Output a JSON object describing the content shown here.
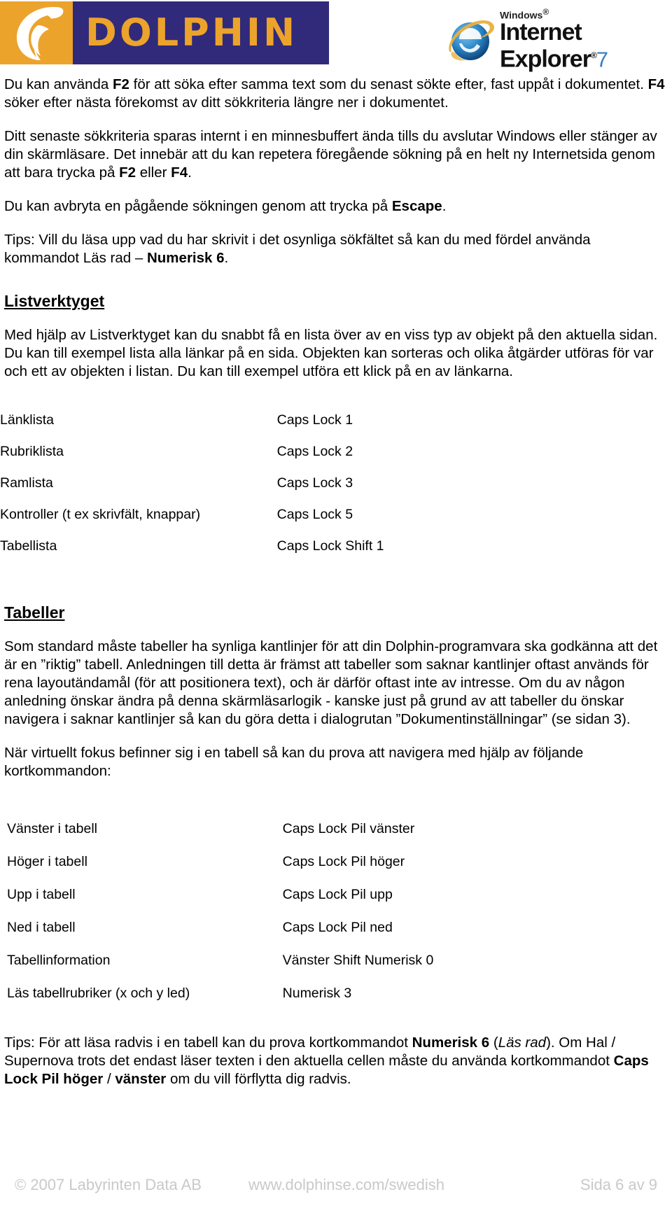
{
  "header": {
    "dolphin_logo": {
      "wordmark": "DOLPHIN",
      "bg_color": "#312a7a",
      "accent_color": "#eca32c"
    },
    "ie_logo": {
      "windows": "Windows",
      "line1": "Internet",
      "line2": "Explorer",
      "version": "7",
      "tm": "®"
    }
  },
  "content": {
    "p1_a": "Du kan använda ",
    "p1_b1": "F2",
    "p1_c": " för att söka efter samma text som du senast sökte efter, fast uppåt i dokumentet. ",
    "p1_b2": "F4",
    "p1_d": " söker efter nästa förekomst av ditt sökkriteria längre ner i dokumentet.",
    "p2_a": "Ditt senaste sökkriteria sparas internt i en minnesbuffert ända tills du avslutar Windows eller stänger av din skärmläsare. Det innebär att du kan repetera föregående sökning på en helt ny Internetsida genom att bara trycka på ",
    "p2_b1": "F2",
    "p2_c": " eller ",
    "p2_b2": "F4",
    "p2_d": ".",
    "p3_a": "Du kan avbryta en pågående sökningen genom att trycka på ",
    "p3_b": "Escape",
    "p3_c": ".",
    "p4_a": "Tips: Vill du läsa upp vad du har skrivit i det osynliga sökfältet så kan du med fördel använda kommandot Läs rad – ",
    "p4_b": "Numerisk 6",
    "p4_c": ".",
    "heading_listverktyget": "Listverktyget",
    "p5": "Med hjälp av Listverktyget kan du snabbt få en lista över av en viss typ av objekt på den aktuella sidan. Du kan till exempel lista alla länkar på en sida. Objekten kan sorteras och olika åtgärder utföras för var och ett av objekten i listan. Du kan till exempel utföra ett klick på en av länkarna.",
    "heading_tabeller": "Tabeller",
    "p6": "Som standard måste tabeller ha synliga kantlinjer för att din Dolphin-programvara ska godkänna att det är en ”riktig” tabell. Anledningen till detta är främst att tabeller som saknar kantlinjer oftast används för rena layoutändamål (för att positionera text), och är därför oftast inte av intresse. Om du av någon anledning önskar ändra på denna skärmläsarlogik - kanske just på grund av att tabeller du önskar navigera i saknar kantlinjer så kan du göra detta i dialogrutan ”Dokumentinställningar” (se sidan 3).",
    "p7": "När virtuellt fokus befinner sig i en tabell så kan du prova att navigera med hjälp av följande kortkommandon:",
    "p8_a": "Tips: För att läsa radvis i en tabell kan du prova kortkommandot ",
    "p8_b1": "Numerisk 6",
    "p8_c": " (",
    "p8_i": "Läs rad",
    "p8_d": "). Om Hal / Supernova trots det endast läser texten i den aktuella cellen måste du använda kortkommandot ",
    "p8_b2": "Caps Lock Pil höger",
    "p8_e": " / ",
    "p8_b3": "vänster",
    "p8_f": " om du vill förflytta dig radvis."
  },
  "list_shortcuts": {
    "rows": [
      {
        "action": "Länklista",
        "key": "Caps Lock 1"
      },
      {
        "action": "Rubriklista",
        "key": "Caps Lock 2"
      },
      {
        "action": "Ramlista",
        "key": "Caps Lock 3"
      },
      {
        "action": "Kontroller (t ex skrivfält, knappar)",
        "key": "Caps Lock 5"
      },
      {
        "action": "Tabellista",
        "key": "Caps Lock Shift 1"
      }
    ]
  },
  "table_shortcuts": {
    "rows": [
      {
        "action": "Vänster i tabell",
        "key": "Caps Lock Pil vänster"
      },
      {
        "action": "Höger i tabell",
        "key": "Caps Lock Pil höger"
      },
      {
        "action": "Upp i tabell",
        "key": "Caps Lock Pil upp"
      },
      {
        "action": "Ned i tabell",
        "key": "Caps Lock Pil ned"
      },
      {
        "action": "Tabellinformation",
        "key": "Vänster Shift Numerisk 0"
      },
      {
        "action": "Läs tabellrubriker (x och y led)",
        "key": "Numerisk 3"
      }
    ]
  },
  "footer": {
    "copyright": "© 2007 Labyrinten Data AB",
    "url": "www.dolphinse.com/swedish",
    "page": "Sida 6 av 9"
  }
}
